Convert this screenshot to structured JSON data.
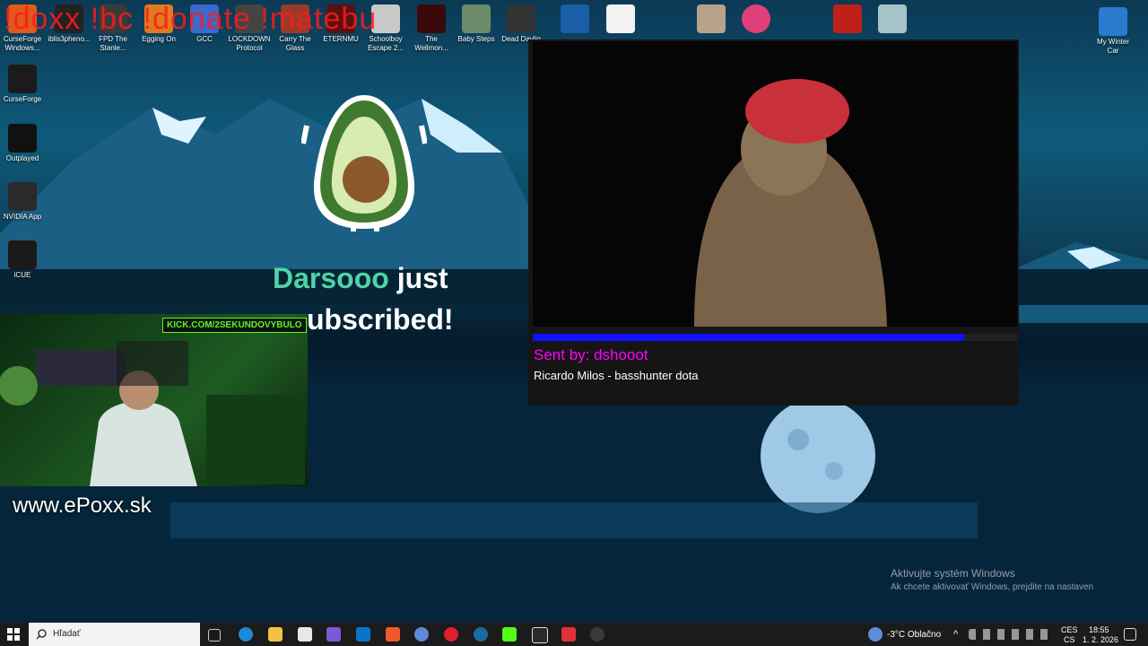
{
  "stream_overlay": {
    "commands_text": "!doxx !bc !donate !matebu",
    "alert": {
      "username": "Darsooo",
      "title_rest": "just",
      "subtitle": "ubscribed!"
    },
    "webcam_badge": "KICK.COM/2SEKUNDOVYBULO",
    "website": "www.ePoxx.sk"
  },
  "media_request": {
    "sent_by": "Sent by: dshooot",
    "song": "Ricardo Milos - basshunter dota",
    "progress": 0.89
  },
  "desktop_icons_top": [
    {
      "label": "CurseForge Windows...",
      "color": "#e05a1b"
    },
    {
      "label": "iblis3pheno...",
      "color": "#222222"
    },
    {
      "label": "FPD The Stanle...",
      "color": "#3a3a3a"
    },
    {
      "label": "Egging On",
      "color": "#e07a20"
    },
    {
      "label": "GCC",
      "color": "#3a6ad0"
    },
    {
      "label": "LOCKDOWN Protocol",
      "color": "#444444"
    },
    {
      "label": "Carry The Glass",
      "color": "#9a3a2a"
    },
    {
      "label": "ETERNMU",
      "color": "#5a1010"
    },
    {
      "label": "Schoolboy Escape 2...",
      "color": "#c8c8c8"
    },
    {
      "label": "The Wellmon...",
      "color": "#3a0a0a"
    },
    {
      "label": "Baby Steps",
      "color": "#6a8a6a"
    },
    {
      "label": "Dead Daylig",
      "color": "#333333"
    }
  ],
  "desktop_icons_left": [
    {
      "label": "CurseForge",
      "color": "#1b1b1b"
    },
    {
      "label": "Outplayed",
      "color": "#111111"
    },
    {
      "label": "NVIDIA App",
      "color": "#2a2a2a"
    },
    {
      "label": "iCUE",
      "color": "#1a1a1a"
    }
  ],
  "desktop_icon_right": {
    "label": "My Winter Car",
    "color": "#2a7ad0"
  },
  "watermark": {
    "line1": "Aktivujte systém Windows",
    "line2": "Ak chcete aktivovať Windows, prejdite na nastaven"
  },
  "taskbar": {
    "search_placeholder": "Hľadať",
    "weather": "-3°C Oblačno",
    "lang_top": "CES",
    "lang_bottom": "CS",
    "time": "18:55",
    "date": "1. 2. 2026"
  }
}
